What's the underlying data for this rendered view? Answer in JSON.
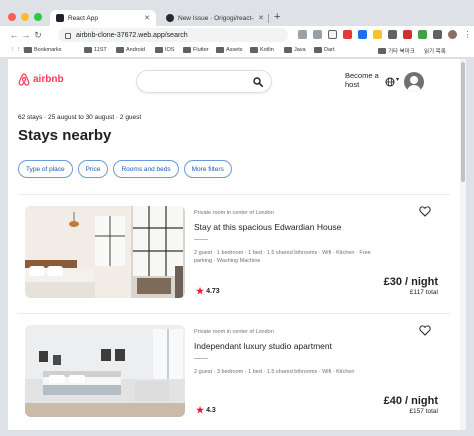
{
  "browser": {
    "tabs": [
      {
        "title": "React App",
        "active": true
      },
      {
        "title": "New Issue · Origogi/react-airb",
        "active": false
      }
    ],
    "url": "airbnb-clone-37672.web.app/search",
    "bookmarks": [
      "Bookmarks",
      "11ST",
      "Android",
      "IOS",
      "Flutter",
      "Assets",
      "Kotlin",
      "Java",
      "Dart",
      "기타 북마크",
      "읽기 목록"
    ],
    "colors": {
      "close": "#ff5f57",
      "minimize": "#febc2e",
      "maximize": "#28c840"
    }
  },
  "header": {
    "logo": "airbnb",
    "host_line1": "Become a",
    "host_line2": "host"
  },
  "search_summary": "62 stays · 25 august to 30 august · 2 guest",
  "page_title": "Stays nearby",
  "filters": [
    "Type of place",
    "Price",
    "Rooms and beds",
    "More filters"
  ],
  "listings": [
    {
      "type": "Private room in center of London",
      "name": "Stay at this spacious Edwardian House",
      "amenities": "2 guest · 1 bedroom · 1 bed · 1.5 shared bthrooms · Wifi · Kitchen · Free parking · Washing Machine",
      "rating": "4.73",
      "price": "£30 / night",
      "total": "£117 total"
    },
    {
      "type": "Private room in center of London",
      "name": "Independant luxury studio apartment",
      "amenities": "2 guest · 3 bedroom · 1 bed · 1.5 shared bthrooms · Wifi · Kitchen",
      "rating": "4.3",
      "price": "£40 / night",
      "total": "£157 total"
    }
  ],
  "accent_color": "#ff385c"
}
